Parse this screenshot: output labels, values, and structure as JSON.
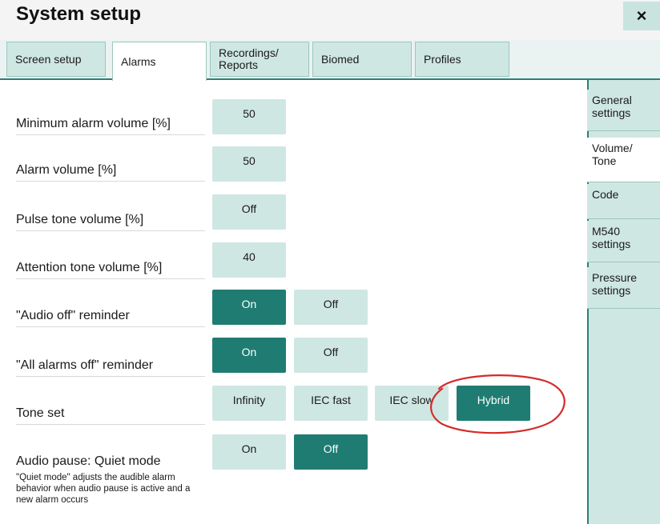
{
  "window": {
    "title": "System setup",
    "close_label": "×"
  },
  "tabs": [
    {
      "label": "Screen setup"
    },
    {
      "label": "Alarms"
    },
    {
      "label": "Recordings/ Reports"
    },
    {
      "label": "Biomed"
    },
    {
      "label": "Profiles"
    }
  ],
  "active_tab": "Alarms",
  "sidebar": {
    "items": [
      {
        "label": "General settings"
      },
      {
        "label": "Volume/ Tone"
      },
      {
        "label": "Code"
      },
      {
        "label": "M540 settings"
      },
      {
        "label": "Pressure settings"
      }
    ],
    "active_item": "Volume/ Tone"
  },
  "settings": {
    "min_alarm_volume": {
      "label": "Minimum alarm volume [%]",
      "value": "50"
    },
    "alarm_volume": {
      "label": "Alarm volume [%]",
      "value": "50"
    },
    "pulse_tone_volume": {
      "label": "Pulse tone volume [%]",
      "value": "Off"
    },
    "attention_tone_volume": {
      "label": "Attention tone volume [%]",
      "value": "40"
    },
    "audio_off_reminder": {
      "label": "\"Audio off\" reminder",
      "on_label": "On",
      "off_label": "Off",
      "selected": "On"
    },
    "all_alarms_off_reminder": {
      "label": "\"All alarms off\" reminder",
      "on_label": "On",
      "off_label": "Off",
      "selected": "On"
    },
    "tone_set": {
      "label": "Tone set",
      "options": [
        "Infinity",
        "IEC fast",
        "IEC slow",
        "Hybrid"
      ],
      "selected": "Hybrid"
    },
    "audio_pause_quiet_mode": {
      "label": "Audio pause: Quiet mode",
      "note": "\"Quiet mode\" adjusts the audible alarm behavior when audio pause is active and a new alarm occurs",
      "on_label": "On",
      "off_label": "Off",
      "selected": "Off"
    }
  },
  "colors": {
    "accent": "#1f7c72",
    "button": "#cfe7e2",
    "annotation_circle": "#d42a2a"
  }
}
